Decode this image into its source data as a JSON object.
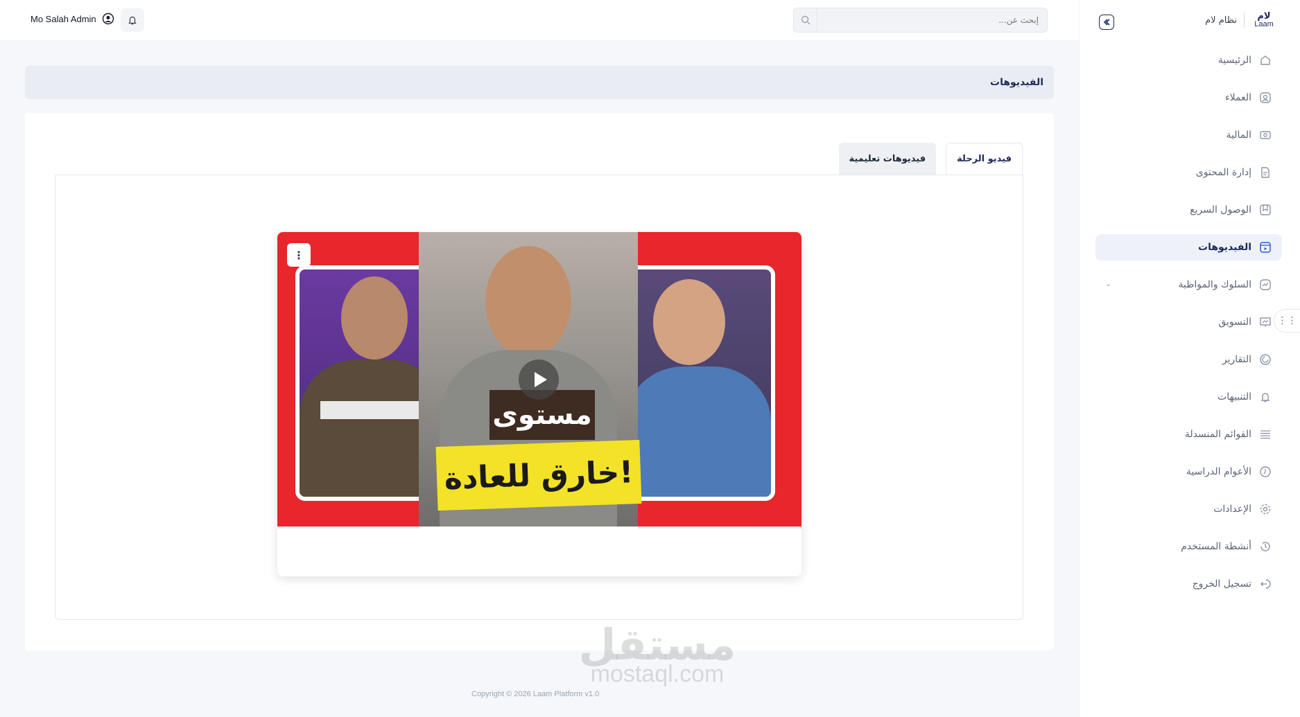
{
  "brand": {
    "logo_ar": "لام",
    "logo_en": "Laam",
    "name": "نظام لام"
  },
  "topbar": {
    "user_name": "Mo Salah Admin",
    "search_placeholder": "إبحث عن..."
  },
  "sidebar": {
    "items": [
      {
        "label": "الرئيسية",
        "icon": "home-icon"
      },
      {
        "label": "العملاء",
        "icon": "user-circle-icon"
      },
      {
        "label": "المالية",
        "icon": "banknote-icon"
      },
      {
        "label": "إدارة المحتوى",
        "icon": "document-icon"
      },
      {
        "label": "الوصول السريع",
        "icon": "bookmark-icon"
      },
      {
        "label": "الفيديوهات",
        "icon": "video-icon",
        "active": true
      },
      {
        "label": "السلوك والمواظبة",
        "icon": "activity-icon",
        "expandable": true
      },
      {
        "label": "التسويق",
        "icon": "presentation-icon"
      },
      {
        "label": "التقارير",
        "icon": "report-icon"
      },
      {
        "label": "التنبيهات",
        "icon": "bell-icon"
      },
      {
        "label": "القوائم المنسدلة",
        "icon": "list-icon"
      },
      {
        "label": "الأعوام الدراسية",
        "icon": "clock-icon"
      },
      {
        "label": "الإعدادات",
        "icon": "gear-icon"
      },
      {
        "label": "أنشطة المستخدم",
        "icon": "history-icon"
      },
      {
        "label": "تسجيل الخروج",
        "icon": "logout-icon"
      }
    ]
  },
  "page": {
    "title": "الفيديوهات",
    "tabs": [
      {
        "label": "فيديو الرحلة",
        "active": true
      },
      {
        "label": "فيديوهات تعليمية",
        "active": false
      }
    ]
  },
  "video": {
    "thumb_text_top": "مستوى",
    "thumb_text_bottom": "خارق للعادة!"
  },
  "footer": {
    "copyright": "Copyright © 2026 Laam Platform v1.0"
  },
  "watermark": {
    "ar": "مستقل",
    "en": "mostaql.com"
  },
  "colors": {
    "brand_navy": "#1e2a5a",
    "accent_blue": "#2f5bd3",
    "thumb_red": "#e8262b",
    "thumb_yellow": "#f3e227"
  }
}
